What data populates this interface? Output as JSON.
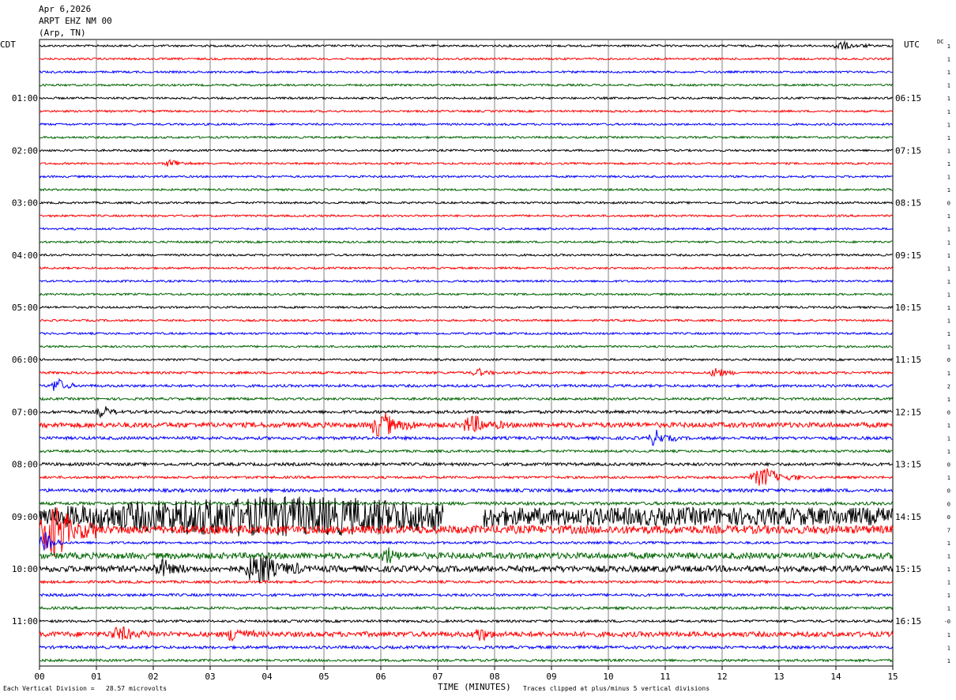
{
  "header": {
    "date": "Apr 6,2026",
    "station": "ARPT EHZ NM 00",
    "location": "(Arp, TN)"
  },
  "left_timezone": "CDT",
  "right_timezone": "UTC",
  "dc_label": "DC",
  "footer": {
    "scale": "Each Vertical Division =   28.57 microvolts",
    "xlabel": "TIME (MINUTES)",
    "clip_note": "Traces clipped at plus/minus 5 vertical divisions"
  },
  "colors": {
    "trace_cycle": [
      "#000000",
      "#ff0000",
      "#0000ff",
      "#006400"
    ],
    "grid": "#808080"
  },
  "chart_data": {
    "type": "line",
    "title": "ARPT EHZ NM 00",
    "xlabel": "TIME (MINUTES)",
    "x_ticks": [
      "00",
      "01",
      "02",
      "03",
      "04",
      "05",
      "06",
      "07",
      "08",
      "09",
      "10",
      "11",
      "12",
      "13",
      "14",
      "15"
    ],
    "xlim": [
      0,
      15
    ],
    "trace_count": 48,
    "left_time_labels": [
      {
        "trace": 4,
        "label": "01:00"
      },
      {
        "trace": 8,
        "label": "02:00"
      },
      {
        "trace": 12,
        "label": "03:00"
      },
      {
        "trace": 16,
        "label": "04:00"
      },
      {
        "trace": 20,
        "label": "05:00"
      },
      {
        "trace": 24,
        "label": "06:00"
      },
      {
        "trace": 28,
        "label": "07:00"
      },
      {
        "trace": 32,
        "label": "08:00"
      },
      {
        "trace": 36,
        "label": "09:00"
      },
      {
        "trace": 40,
        "label": "10:00"
      },
      {
        "trace": 44,
        "label": "11:00"
      }
    ],
    "right_time_labels": [
      {
        "trace": 4,
        "label": "06:15"
      },
      {
        "trace": 8,
        "label": "07:15"
      },
      {
        "trace": 12,
        "label": "08:15"
      },
      {
        "trace": 16,
        "label": "09:15"
      },
      {
        "trace": 20,
        "label": "10:15"
      },
      {
        "trace": 24,
        "label": "11:15"
      },
      {
        "trace": 28,
        "label": "12:15"
      },
      {
        "trace": 32,
        "label": "13:15"
      },
      {
        "trace": 36,
        "label": "14:15"
      },
      {
        "trace": 40,
        "label": "15:15"
      },
      {
        "trace": 44,
        "label": "16:15"
      }
    ],
    "dc_offsets": [
      "1",
      "1",
      "1",
      "1",
      "1",
      "1",
      "1",
      "1",
      "1",
      "1",
      "1",
      "1",
      "0",
      "1",
      "1",
      "1",
      "1",
      "1",
      "1",
      "1",
      "1",
      "1",
      "1",
      "1",
      "0",
      "1",
      "2",
      "1",
      "0",
      "1",
      "1",
      "1",
      "0",
      "1",
      "0",
      "0",
      "0",
      "7",
      "1",
      "1",
      "1",
      "1",
      "1",
      "1",
      "-0",
      "1",
      "1",
      "1"
    ],
    "noise_level": [
      1,
      1,
      1,
      1,
      1,
      1,
      1,
      1,
      1,
      1,
      1,
      1,
      1,
      1,
      1,
      1,
      1,
      1,
      1,
      1,
      1,
      1,
      1,
      1,
      1,
      1.2,
      1.3,
      1.2,
      1.5,
      2.5,
      1.5,
      1.2,
      1.5,
      1.2,
      1.6,
      1.5,
      6,
      4,
      1.2,
      3,
      3,
      1.3,
      1.3,
      1.3,
      1.2,
      2.5,
      1.4,
      1.2
    ],
    "events": [
      {
        "trace": 0,
        "start": 13.9,
        "end": 14.6,
        "amp": 2
      },
      {
        "trace": 9,
        "start": 2.2,
        "end": 2.7,
        "amp": 2
      },
      {
        "trace": 25,
        "start": 7.6,
        "end": 8.0,
        "amp": 2
      },
      {
        "trace": 25,
        "start": 11.8,
        "end": 12.2,
        "amp": 3
      },
      {
        "trace": 26,
        "start": 0.2,
        "end": 0.6,
        "amp": 4
      },
      {
        "trace": 28,
        "start": 1.0,
        "end": 1.4,
        "amp": 3
      },
      {
        "trace": 29,
        "start": 5.8,
        "end": 6.6,
        "amp": 6
      },
      {
        "trace": 29,
        "start": 7.4,
        "end": 8.2,
        "amp": 4
      },
      {
        "trace": 30,
        "start": 10.7,
        "end": 11.2,
        "amp": 4
      },
      {
        "trace": 33,
        "start": 12.5,
        "end": 13.4,
        "amp": 5
      },
      {
        "trace": 36,
        "start": 0.0,
        "end": 15.0,
        "amp": 8
      },
      {
        "trace": 37,
        "start": 0.0,
        "end": 1.0,
        "amp": 14
      },
      {
        "trace": 38,
        "start": 0.0,
        "end": 0.4,
        "amp": 6
      },
      {
        "trace": 39,
        "start": 6.0,
        "end": 6.4,
        "amp": 4
      },
      {
        "trace": 40,
        "start": 3.6,
        "end": 4.6,
        "amp": 8
      },
      {
        "trace": 40,
        "start": 2.0,
        "end": 2.6,
        "amp": 4
      },
      {
        "trace": 45,
        "start": 3.3,
        "end": 3.8,
        "amp": 4
      },
      {
        "trace": 45,
        "start": 7.6,
        "end": 8.1,
        "amp": 3
      },
      {
        "trace": 45,
        "start": 1.2,
        "end": 2.0,
        "amp": 3
      }
    ],
    "gaps": [
      {
        "trace": 36,
        "start": 7.1,
        "end": 7.8
      }
    ]
  }
}
